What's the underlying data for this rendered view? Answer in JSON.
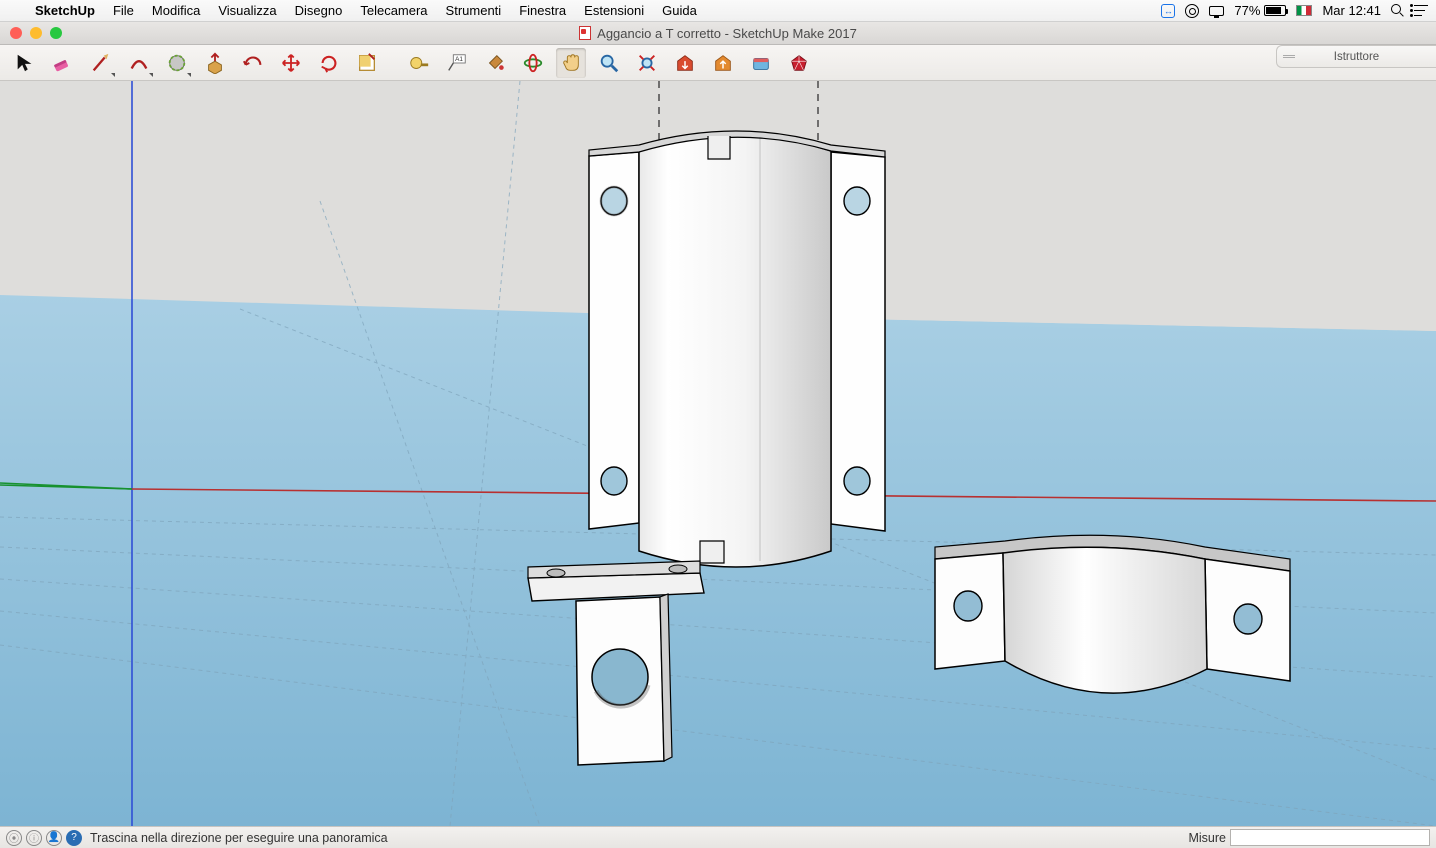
{
  "macmenu": {
    "app": "SketchUp",
    "items": [
      "File",
      "Modifica",
      "Visualizza",
      "Disegno",
      "Telecamera",
      "Strumenti",
      "Finestra",
      "Estensioni",
      "Guida"
    ],
    "battery_pct": "77%",
    "locale_flag": "IT",
    "clock": "Mar 12:41"
  },
  "window": {
    "title": "Aggancio a T corretto - SketchUp Make 2017"
  },
  "instructor_label": "Istruttore",
  "toolbar_icons": [
    "select-arrow",
    "eraser",
    "pencil",
    "arc",
    "circle",
    "pushpull",
    "offset",
    "move",
    "rotate",
    "rectangle-guide",
    "tape-measure",
    "text-label",
    "paint-bucket",
    "orbit-green",
    "orbit-hand",
    "zoom",
    "zoom-extents",
    "3dwh-red",
    "3dwh-orange",
    "3dwh-share",
    "ruby"
  ],
  "status": {
    "hint": "Trascina nella direzione per eseguire una panoramica",
    "measure_label": "Misure",
    "measure_value": ""
  }
}
